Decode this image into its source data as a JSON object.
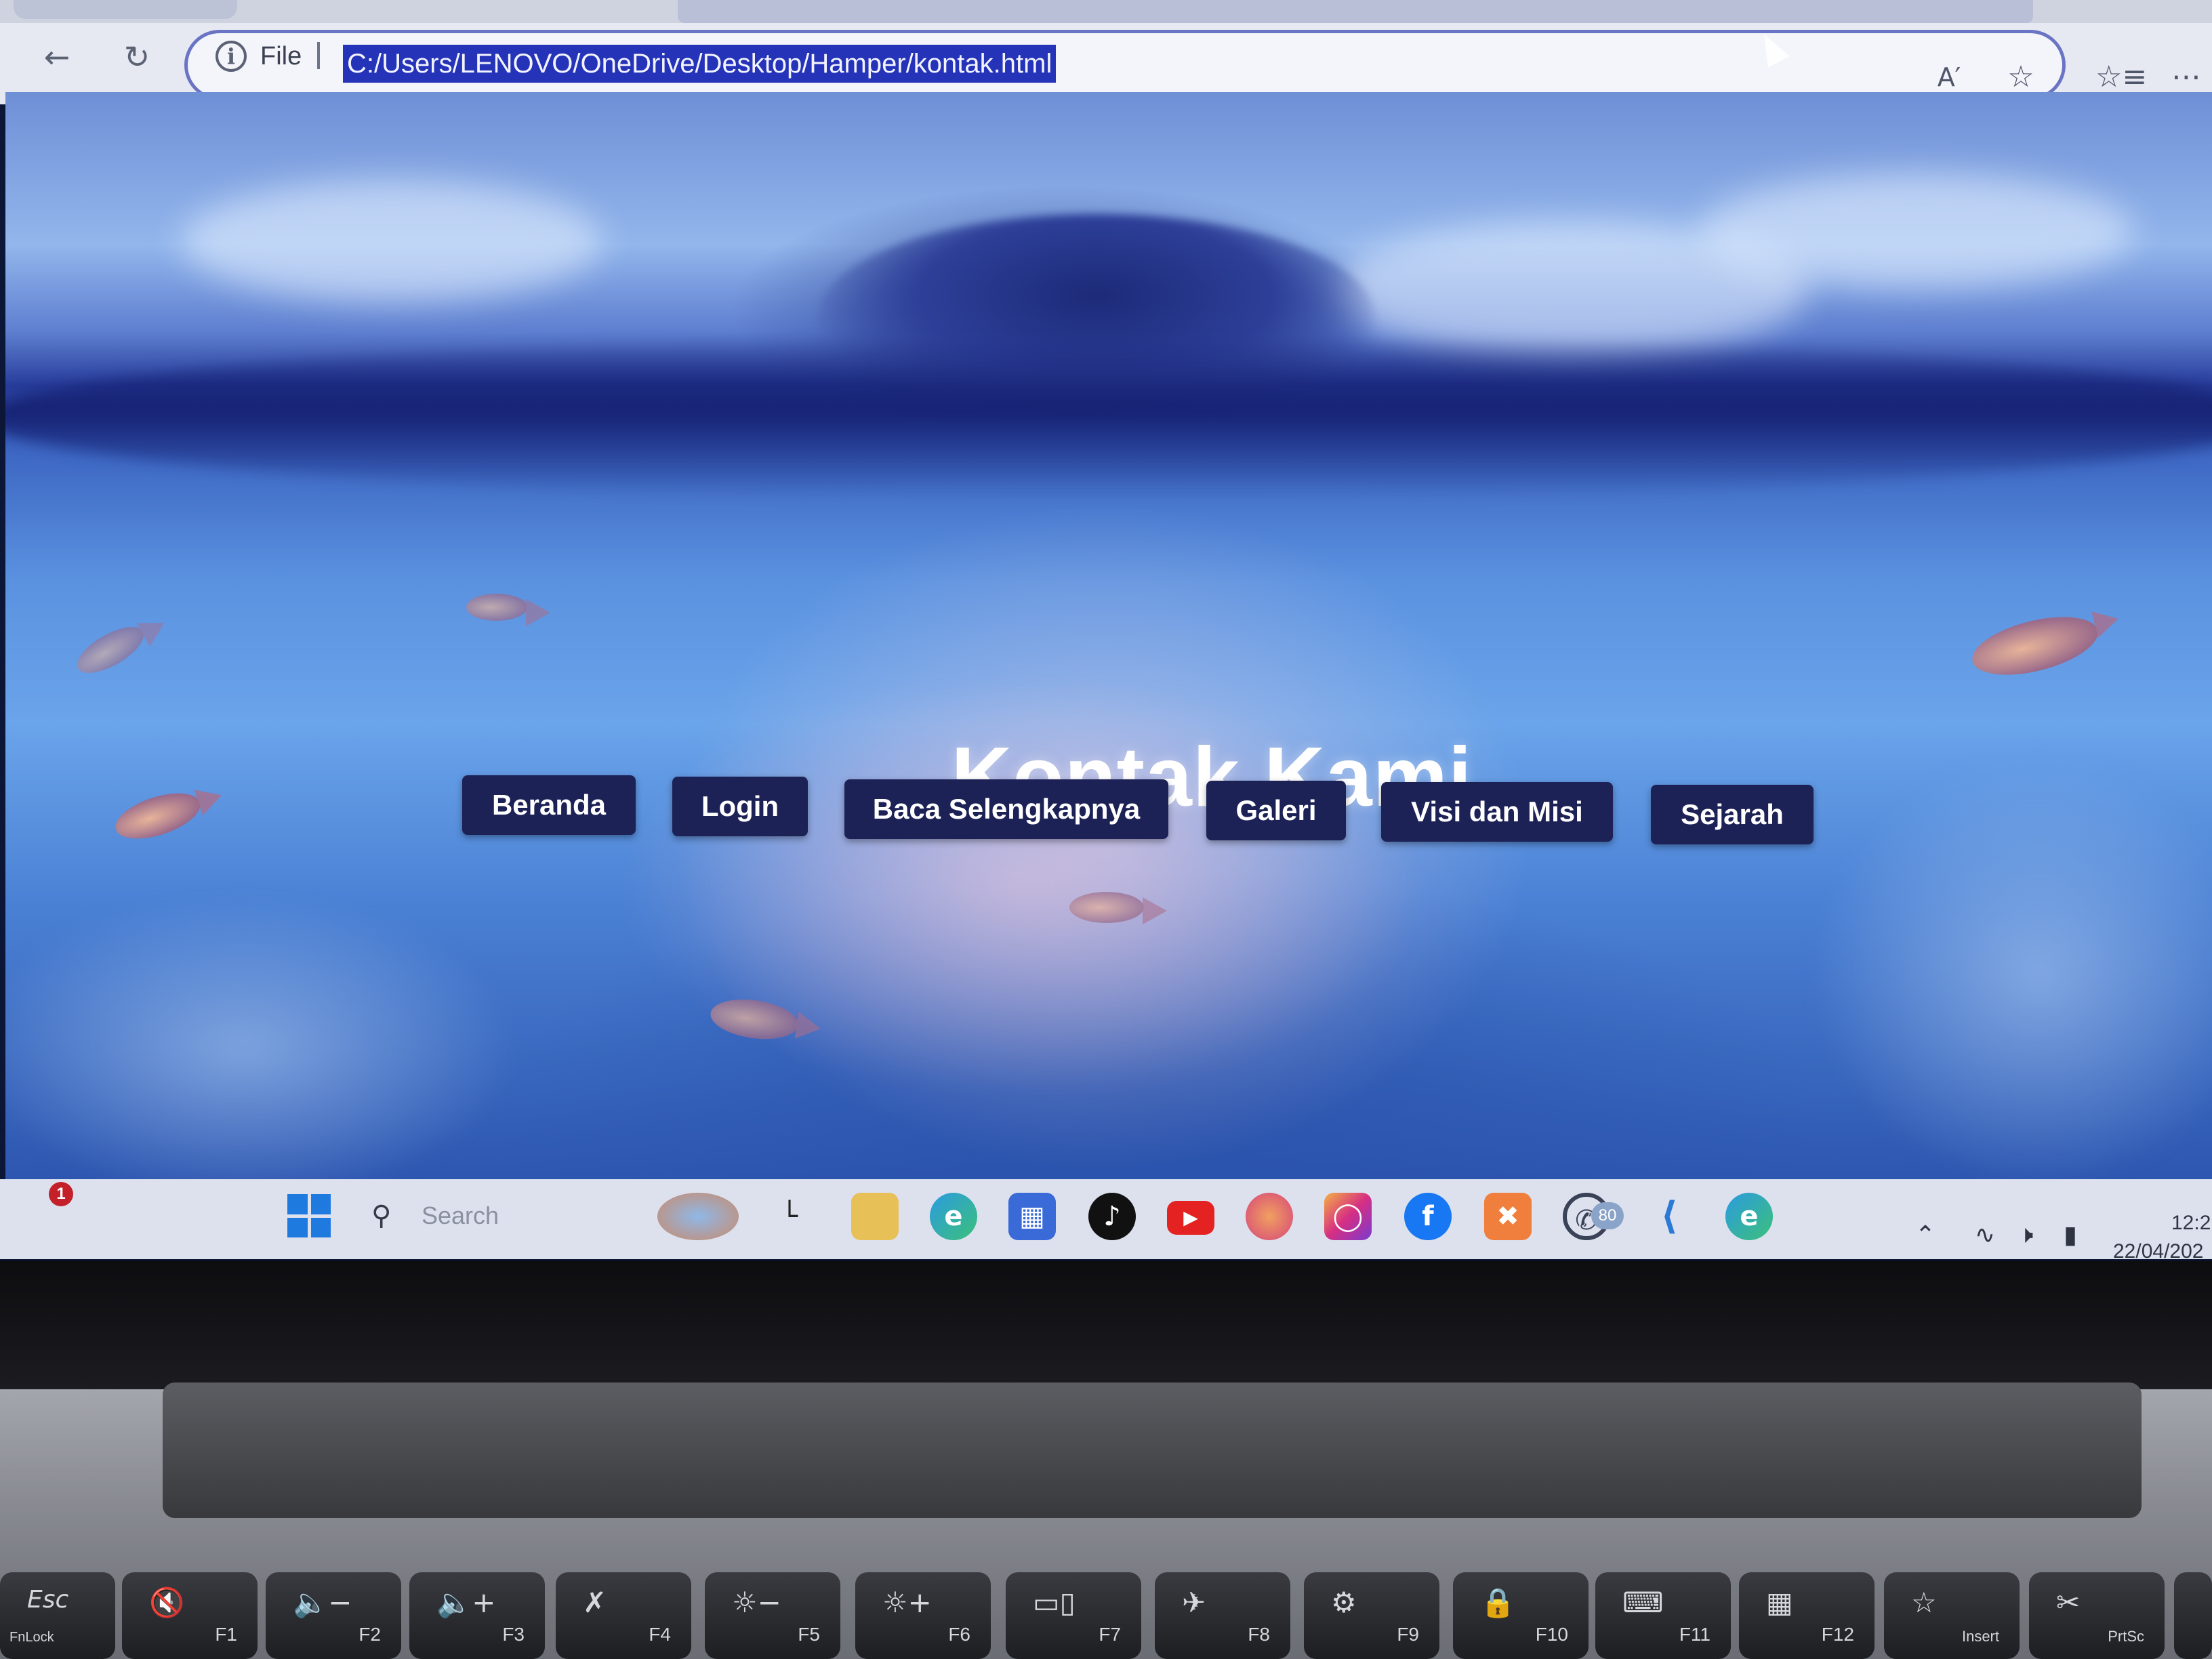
{
  "browser": {
    "address_bar": {
      "scheme_label": "File",
      "url": "C:/Users/LENOVO/OneDrive/Desktop/Hamper/kontak.html"
    },
    "icons": {
      "back": "back-arrow-icon",
      "refresh": "refresh-icon",
      "info": "info-icon",
      "read_aloud": "read-aloud-icon",
      "favorite": "star-icon",
      "favorites_list": "favorites-icon",
      "more": "more-icon"
    }
  },
  "page": {
    "title": "Kontak Kami",
    "nav": [
      "Beranda",
      "Login",
      "Baca Selengkapnya",
      "Galeri",
      "Visi dan Misi",
      "Sejarah"
    ],
    "colors": {
      "button_bg": "#1c2156",
      "button_text": "#ffffff",
      "title": "#ffffff"
    }
  },
  "taskbar": {
    "notification_count": "1",
    "search_placeholder": "Search",
    "apps": [
      "weather-widget",
      "task-view",
      "file-explorer",
      "edge",
      "microsoft-store",
      "tiktok",
      "youtube",
      "firefox",
      "instagram",
      "facebook",
      "xampp",
      "whatsapp",
      "vs-code",
      "edge-active"
    ],
    "whatsapp_badge": "80",
    "clock": {
      "time": "12:2",
      "date": "22/04/202"
    }
  },
  "keyboard": {
    "keys": [
      {
        "label": "Esc",
        "sub": "FnLock"
      },
      {
        "label": "F1",
        "icon": "mute-icon"
      },
      {
        "label": "F2",
        "icon": "volume-down-icon"
      },
      {
        "label": "F3",
        "icon": "volume-up-icon"
      },
      {
        "label": "F4",
        "icon": "mic-mute-icon"
      },
      {
        "label": "F5",
        "icon": "brightness-down-icon"
      },
      {
        "label": "F6",
        "icon": "brightness-up-icon"
      },
      {
        "label": "F7",
        "icon": "display-icon"
      },
      {
        "label": "F8",
        "icon": "airplane-icon"
      },
      {
        "label": "F9",
        "icon": "settings-icon"
      },
      {
        "label": "F10",
        "icon": "lock-icon"
      },
      {
        "label": "F11",
        "icon": "keyboard-icon"
      },
      {
        "label": "F12",
        "icon": "calculator-icon"
      },
      {
        "label": "Insert",
        "icon": "favorite-icon"
      },
      {
        "label": "PrtSc",
        "icon": "snip-icon"
      }
    ]
  }
}
